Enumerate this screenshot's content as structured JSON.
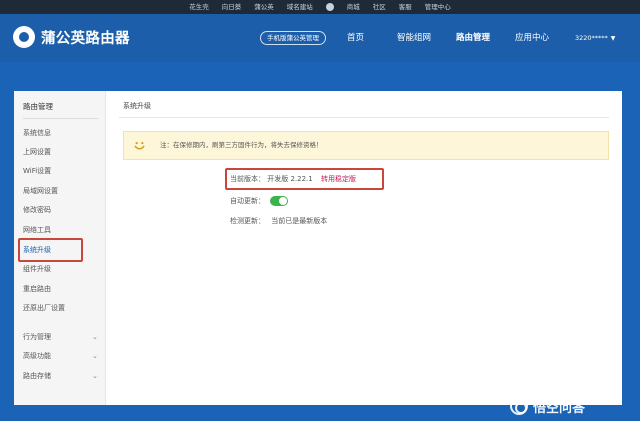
{
  "topbar": {
    "links": [
      "花生壳",
      "向日葵",
      "蒲公英",
      "域名建站",
      "商城",
      "社区",
      "客服",
      "管理中心"
    ]
  },
  "header": {
    "logo_text": "蒲公英路由器",
    "mgmt_button": "手机版蒲公英管理",
    "nav": [
      "首页",
      "智能组网",
      "路由管理",
      "应用中心"
    ],
    "active_nav": "路由管理",
    "user": "3220*****"
  },
  "sidebar": {
    "title": "路由管理",
    "items": [
      "系统信息",
      "上网设置",
      "WiFi设置",
      "局域网设置",
      "修改密码",
      "网络工具",
      "系统升级",
      "组件升级",
      "重启路由",
      "还原出厂设置"
    ],
    "active_item": "系统升级",
    "groups": [
      "行为管理",
      "高级功能",
      "路由存储"
    ]
  },
  "main": {
    "page_title": "系统升级",
    "notice": "注：在保修期内，刷第三方固件行为，将失去保修资格！",
    "current_version_label": "当前版本：",
    "current_version_value": "开发版  2.22.1",
    "switch_link": "转用稳定版",
    "auto_update_label": "自动更新：",
    "auto_update_enabled": true,
    "check_update_label": "检测更新：",
    "check_update_value": "当前已是最新版本"
  },
  "watermark": {
    "text": "悟空问答"
  },
  "colors": {
    "topbar_bg": "#1e2a38",
    "header_bg": "#1c5ea9",
    "page_bg": "#1a63b7",
    "highlight_red": "#c9463d",
    "toggle_green": "#3cb34a",
    "link_pink": "#c2185b",
    "notice_bg": "#fdf6d9"
  }
}
